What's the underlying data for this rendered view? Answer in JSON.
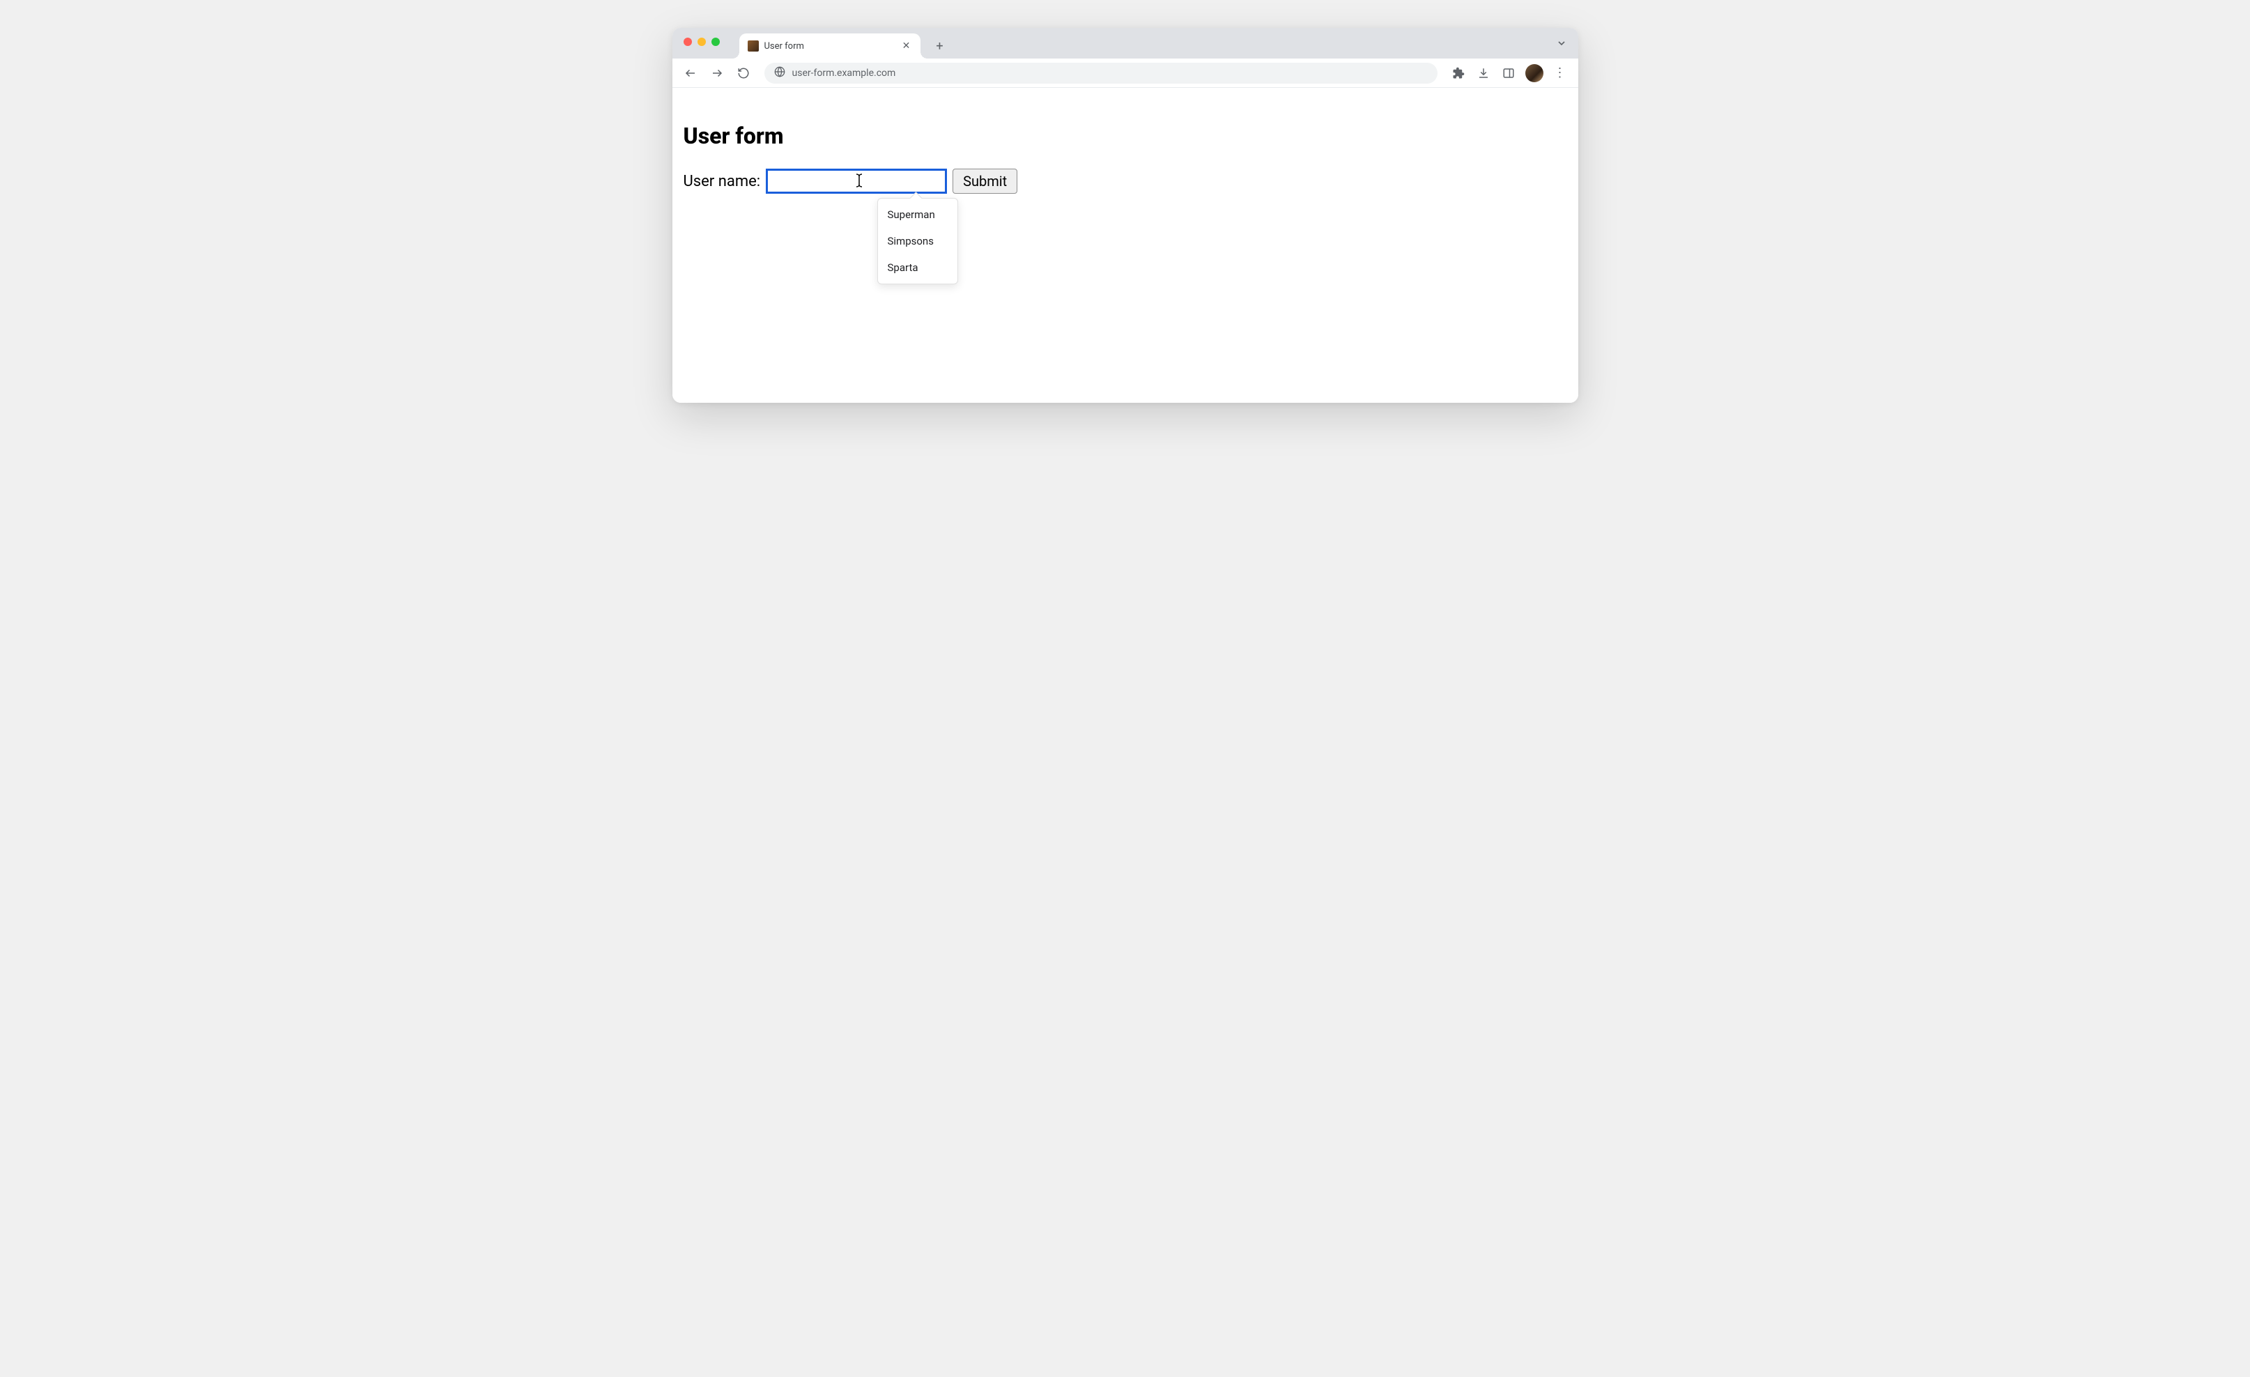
{
  "browser": {
    "tab": {
      "title": "User form",
      "close_glyph": "✕"
    },
    "new_tab_glyph": "+",
    "tabs_dropdown_glyph": "⌄",
    "address_bar": {
      "url": "user-form.example.com"
    },
    "menu_glyph": "⋮"
  },
  "page": {
    "heading": "User form",
    "form": {
      "label": "User name:",
      "input_value": "",
      "submit_label": "Submit"
    },
    "autocomplete": {
      "items": [
        "Superman",
        "Simpsons",
        "Sparta"
      ]
    }
  }
}
